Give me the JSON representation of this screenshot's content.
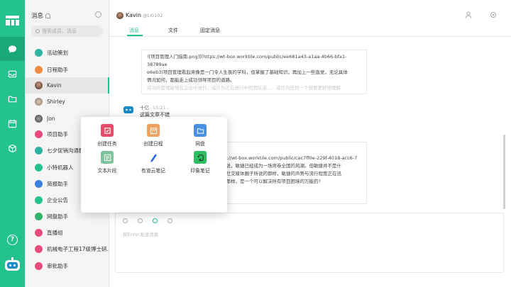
{
  "sidebar": {
    "title": "消息",
    "search_placeholder": "搜索成员、消息",
    "items": [
      {
        "label": "活动策划",
        "color": "#2bb3a3"
      },
      {
        "label": "日程助手",
        "color": "#f08a3c"
      },
      {
        "label": "Kavin",
        "color": "#8a6a58"
      },
      {
        "label": "Shirley",
        "color": "#b0a090"
      },
      {
        "label": "Jon",
        "color": "#707070"
      },
      {
        "label": "项目助手",
        "color": "#e84b7a"
      },
      {
        "label": "七夕促销沟通群",
        "color": "#2bb3a3"
      },
      {
        "label": "小特机器人",
        "color": "#22c38e"
      },
      {
        "label": "简报助手",
        "color": "#3d7fe0"
      },
      {
        "label": "企业公告",
        "color": "#22c38e"
      },
      {
        "label": "网盘助手",
        "color": "#2fb36b"
      },
      {
        "label": "直播组",
        "color": "#e84b7a"
      },
      {
        "label": "机械电子工程17级博士研...",
        "color": "#e84b7a"
      },
      {
        "label": "审批助手",
        "color": "#e84b7a"
      }
    ]
  },
  "chat": {
    "name": "Kavin",
    "handle": "@Li0102",
    "tabs": [
      "消息",
      "文件",
      "固定消息"
    ],
    "card1": [
      "![项目管理入门指南.png]](https://wt-box.worktile.com/public/ee681a43-a1aa-4b66-bfa1-38789ae",
      "e6eb3)项目管理看起来像是一门令人生畏的学科，但掌握了基础知识，再加上一些直觉，无论具体",
      "情况如何，都能走上成功领导项目的道路。",
      "成功的管理能够在企业中进行，或作为正在进行中的团队讲……或作为任何一个想要更好地理解"
    ],
    "sender": "十亿",
    "time": "15:21",
    "msg_line": "这篇文章不错",
    "card2": [
      "人?",
      "ps://wt-box.worktile.com/public/cac7ff0e-229f-4018-acc6-7",
      "来说，敏捷已经成为一场席卷全国的风潮。但敏捷并不是什",
      "在社交媒体圈子所说的那样，敏捷的声势与流行程度正在迅",
      "的那样，是一个可以解决所有项目困境的万能药?"
    ],
    "input_placeholder": "按Enter发送消息"
  },
  "popup": {
    "apps": [
      {
        "label": "创建任务",
        "color": "#e84b6a",
        "icon": "task-icon"
      },
      {
        "label": "创建日程",
        "color": "#f0a060",
        "icon": "calendar-icon"
      },
      {
        "label": "网盘",
        "color": "#4a90e2",
        "icon": "folder-icon"
      },
      {
        "label": "文本片段",
        "color": "#7cc59a",
        "icon": "snippet-icon"
      },
      {
        "label": "有道云笔记",
        "color": "#2a6fdf",
        "icon": "youdao-icon"
      },
      {
        "label": "印象笔记",
        "color": "#2dbe60",
        "icon": "evernote-icon"
      }
    ]
  }
}
